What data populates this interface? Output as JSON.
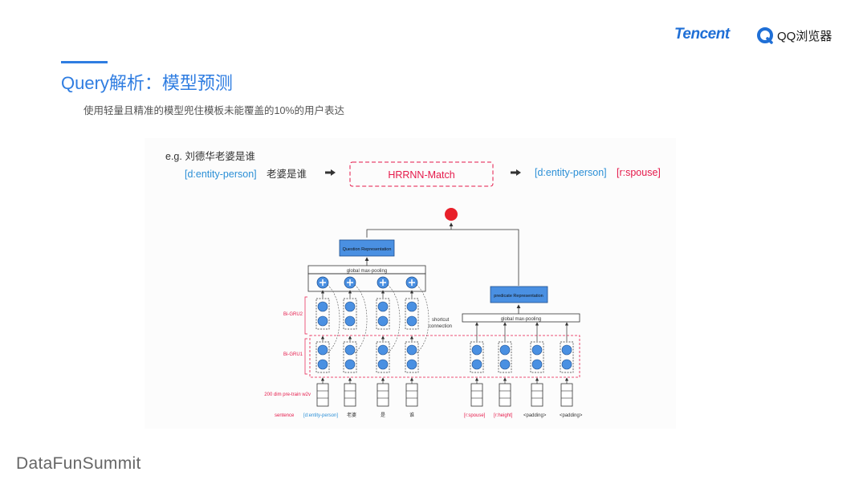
{
  "header": {
    "brand_tencent": "Tencent",
    "brand_qq": "QQ浏览器",
    "title": "Query解析：模型预测",
    "subtitle": "使用轻量且精准的模型兜住模板未能覆盖的10%的用户表达"
  },
  "example": {
    "query": "e.g. 刘德华老婆是谁",
    "input_entity": "[d:entity-person]",
    "input_text": "老婆是谁",
    "model_name": "HRRNN-Match",
    "output_entity": "[d:entity-person]",
    "output_relation": "[r:spouse]"
  },
  "network": {
    "question_box": "Question Representation",
    "predicate_box": "predicate Representation",
    "pooling_left": "global max-pooling",
    "pooling_right": "global max-pooling",
    "label_bigru2": "Bi-GRU2",
    "label_bigru1": "Bi-GRU1",
    "label_w2v": "200 dim pre-train w2v",
    "shortcut": "shortcut connection",
    "token_sentence": "sentence",
    "token_entity": "[d:entity-person]",
    "token_laopo": "老婆",
    "token_shi": "是",
    "token_shui": "谁",
    "token_spouse": "[r:spouse]",
    "token_height": "[r:height]",
    "token_padding1": "<padding>",
    "token_padding2": "<padding>"
  },
  "footer": {
    "brand": "DataFunSummit"
  },
  "colors": {
    "accent": "#2f7de1",
    "red": "#e5194a",
    "node": "#4a90e2",
    "output": "#e8202a"
  }
}
